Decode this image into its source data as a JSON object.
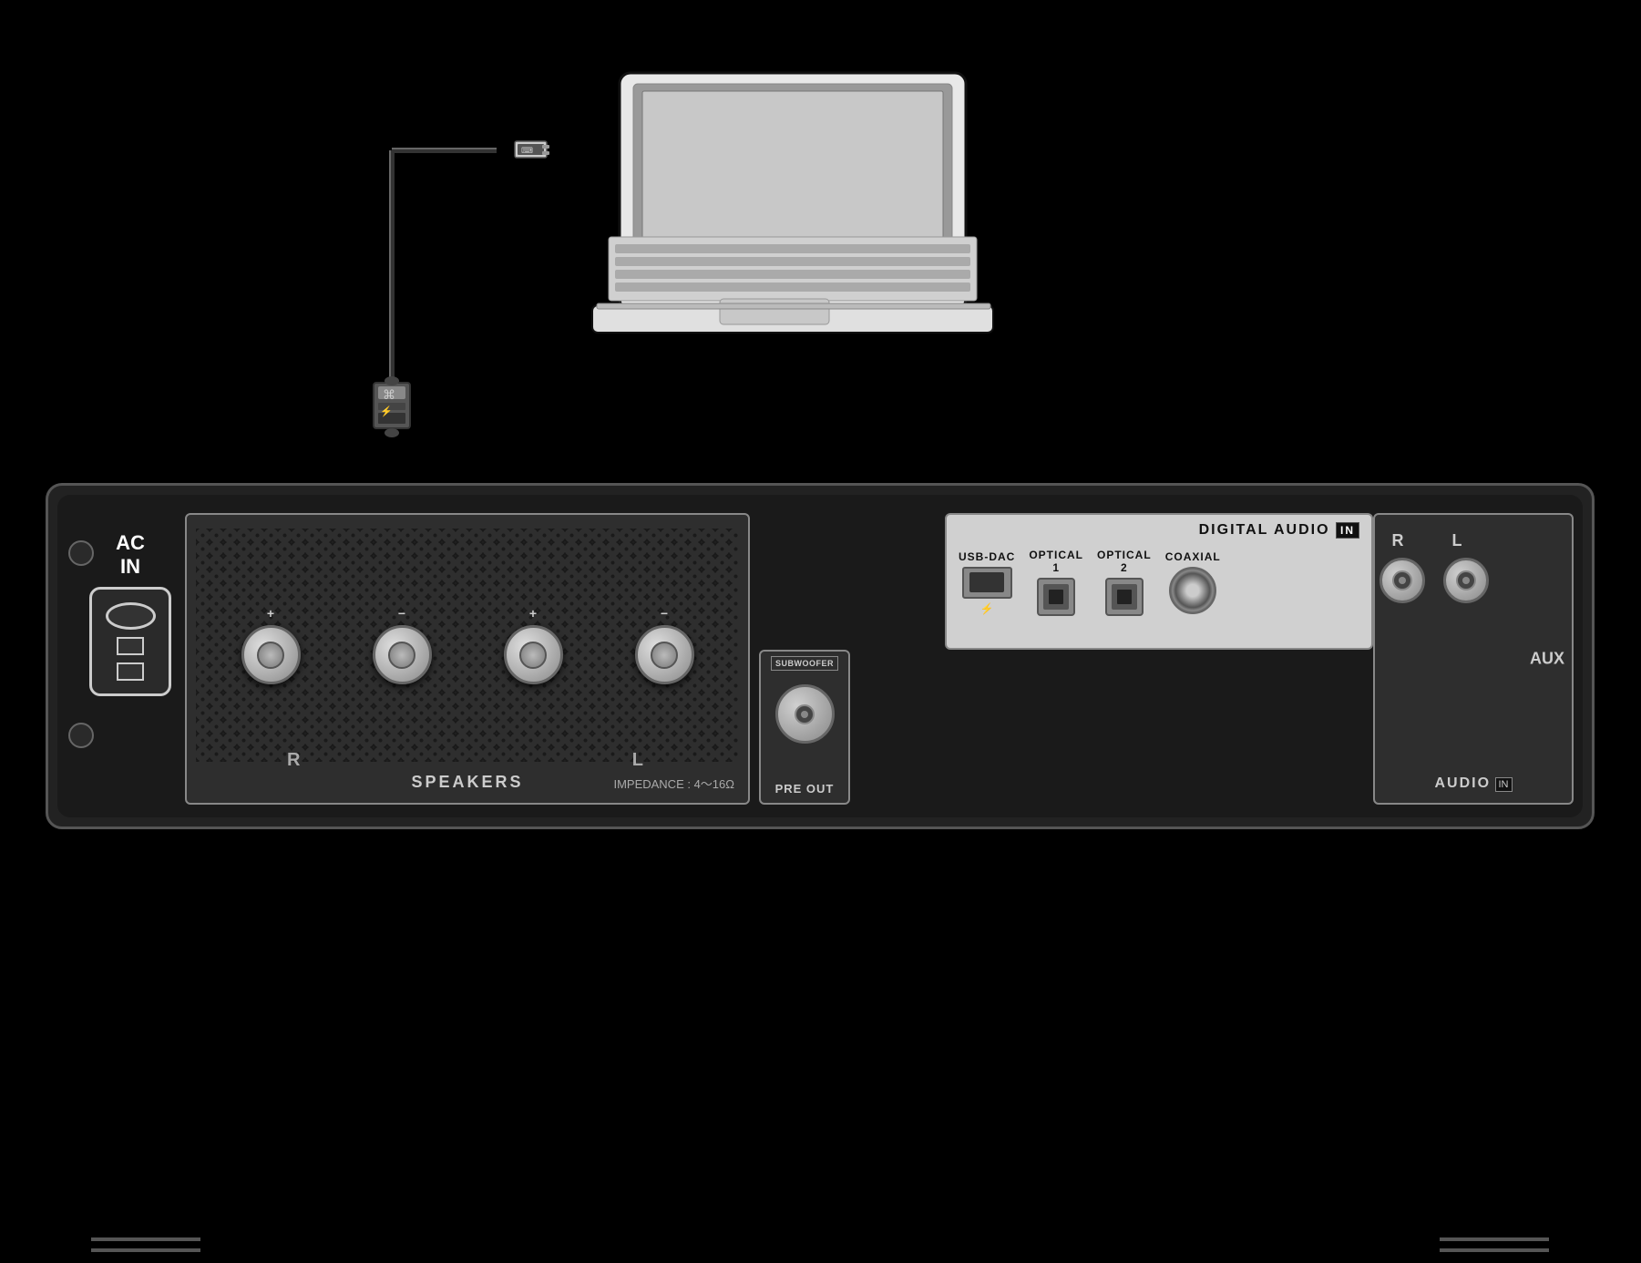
{
  "background_color": "#000000",
  "labels": {
    "ac_in": "AC\nIN",
    "ac_in_line1": "AC",
    "ac_in_line2": "IN",
    "speakers": "SPEAKERS",
    "impedance": "IMPEDANCE : 4～16Ω",
    "digital_audio": "DIGITAL AUDIO",
    "digital_in": "IN",
    "usb_dac": "USB-DAC",
    "optical_1": "OPTICAL\n1",
    "optical_1_line1": "OPTICAL",
    "optical_1_line2": "1",
    "optical_2": "OPTICAL\n2",
    "optical_2_line1": "OPTICAL",
    "optical_2_line2": "2",
    "coaxial": "COAXIAL",
    "audio_in": "IN",
    "audio": "AUDIO",
    "aux": "AUX",
    "r_label": "R",
    "l_label": "L",
    "pre_out": "PRE OUT",
    "subwoofer": "SUBWOOFER",
    "channel_r": "R",
    "channel_l": "L",
    "usb_symbol": "⌘"
  },
  "colors": {
    "panel_dark": "#1a1a1a",
    "panel_mid": "#2e2e2e",
    "panel_light": "#d0d0d0",
    "text_white": "#ffffff",
    "text_light": "#cccccc",
    "border": "#888888",
    "connector": "#888888"
  }
}
